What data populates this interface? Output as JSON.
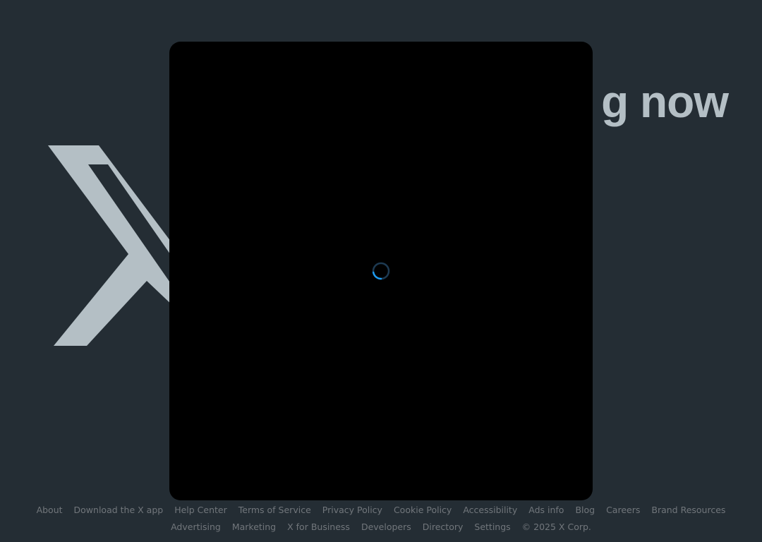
{
  "background": {
    "logo_icon": "x-logo-icon",
    "headline": "Happening now",
    "headline_visible": "g now"
  },
  "modal": {
    "spinner_icon": "loading-spinner-icon",
    "spinner_color": "#1d9bf0"
  },
  "footer": {
    "row1": [
      {
        "label": "About"
      },
      {
        "label": "Download the X app"
      },
      {
        "label": "Help Center"
      },
      {
        "label": "Terms of Service"
      },
      {
        "label": "Privacy Policy"
      },
      {
        "label": "Cookie Policy"
      },
      {
        "label": "Accessibility"
      },
      {
        "label": "Ads info"
      },
      {
        "label": "Blog"
      },
      {
        "label": "Careers"
      },
      {
        "label": "Brand Resources"
      }
    ],
    "row2": [
      {
        "label": "Advertising"
      },
      {
        "label": "Marketing"
      },
      {
        "label": "X for Business"
      },
      {
        "label": "Developers"
      },
      {
        "label": "Directory"
      },
      {
        "label": "Settings"
      }
    ],
    "copyright": "© 2025 X Corp."
  },
  "colors": {
    "page_bg": "#242d34",
    "logo_gray": "#b4bfc5",
    "modal_bg": "#000000",
    "footer_text": "#71767b",
    "accent": "#1d9bf0"
  }
}
